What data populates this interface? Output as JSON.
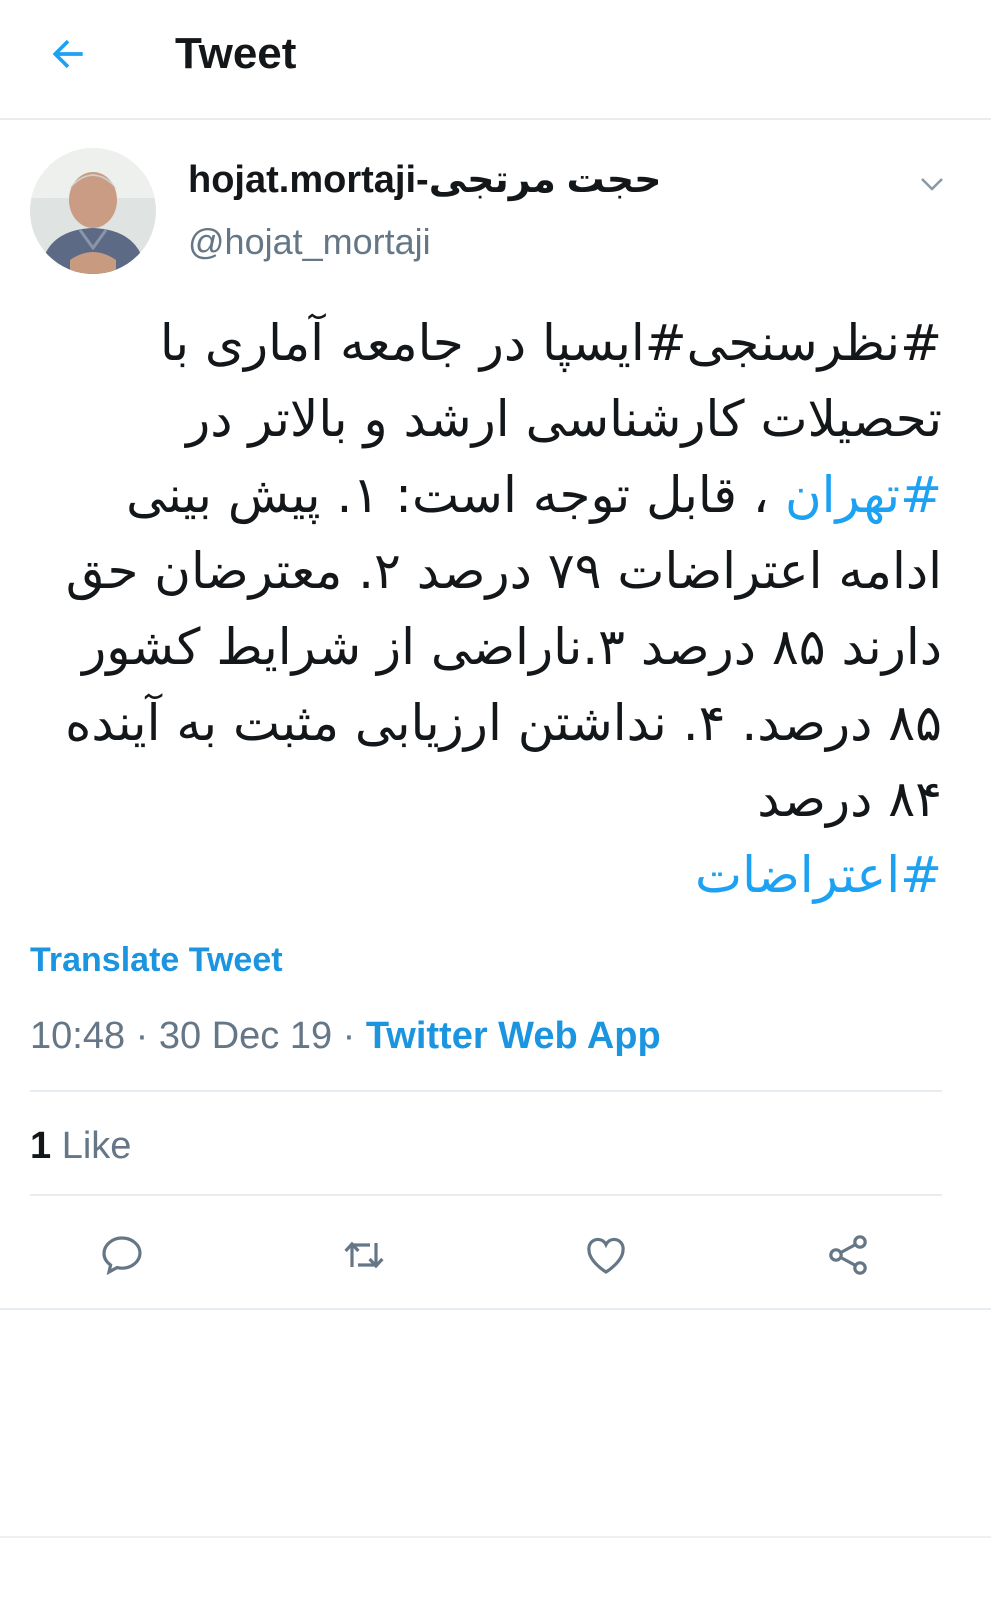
{
  "header": {
    "title": "Tweet",
    "back_icon": "arrow-left-icon"
  },
  "author": {
    "display_name": "hojat.mortaji-حجت مرتجی",
    "handle": "@hojat_mortaji",
    "avatar_icon": "profile-photo"
  },
  "tweet": {
    "line1": "#نظرسنجی#ایسپا در جامعه آماری با",
    "line2": "تحصیلات کارشناسی ارشد و بالاتر در",
    "line3_tag": "#تهران",
    "line3_text": " ، قابل توجه است: ۱. پیش بینی",
    "line4": "ادامه اعتراضات ۷۹ درصد ۲. معترضان حق",
    "line5": "دارند ۸۵ درصد ۳.ناراضی از شرایط کشور",
    "line6": "۸۵ درصد. ۴. نداشتن ارزیابی مثبت به آینده",
    "line7": "۸۴ درصد",
    "line8_tag": "#اعتراضات"
  },
  "translate_label": "Translate Tweet",
  "meta": {
    "time": "10:48",
    "sep1": " · ",
    "date": "30 Dec 19",
    "sep2": " · ",
    "source": "Twitter Web App"
  },
  "stats": {
    "likes_count": "1",
    "likes_label": "Like"
  },
  "actions": [
    "reply-icon",
    "retweet-icon",
    "like-icon",
    "share-icon"
  ],
  "colors": {
    "accent": "#1da1f2",
    "link": "#1b95e0",
    "muted": "#657786",
    "divider": "#e6ecf0"
  }
}
